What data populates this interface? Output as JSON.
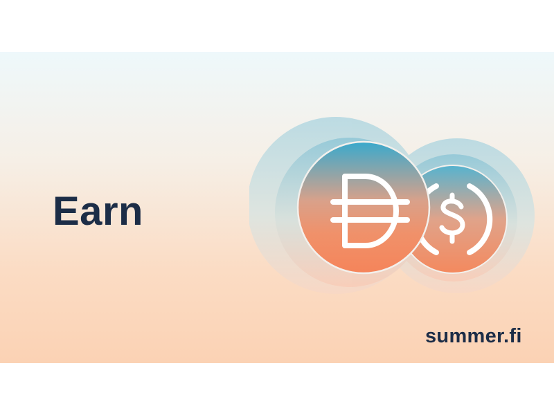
{
  "banner": {
    "headline": "Earn",
    "brand": "summer.fi"
  },
  "icons": {
    "primary_token": "dai-coin-icon",
    "secondary_token": "usdc-coin-icon"
  },
  "colors": {
    "text": "#1c2d47",
    "coin_top": "#3aa9cc",
    "coin_bottom": "#f2885c",
    "halo": "#a9d3df"
  }
}
